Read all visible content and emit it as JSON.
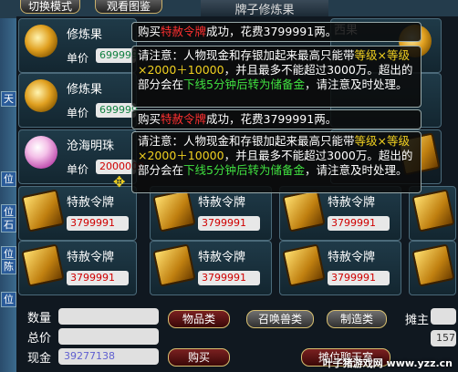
{
  "tabs": {
    "switch_mode": "切换模式",
    "view_catalog": "观看图鉴"
  },
  "window_title": "牌子修炼果",
  "left_strip": [
    "天",
    "位",
    "位",
    "石",
    "位",
    "陈",
    "位"
  ],
  "items": [
    {
      "name": "修炼果",
      "price_label": "单价",
      "price": "699999",
      "icon": "fruit-icon"
    },
    {
      "name": "修炼果",
      "price_label": "单价",
      "price": "699999",
      "icon": "fruit-icon"
    },
    {
      "name": "沧海明珠",
      "price_label": "单价",
      "price": "2000000",
      "icon": "pearl-icon"
    },
    {
      "name": "特赦令牌",
      "price": "3799991",
      "icon": "token-icon"
    },
    {
      "name": "特赦令牌",
      "price": "3799991",
      "icon": "token-icon"
    },
    {
      "name": "特赦令牌",
      "price": "3799991",
      "icon": "token-icon"
    },
    {
      "name": "特赦令牌",
      "price": "3799991",
      "icon": "token-icon"
    },
    {
      "name": "特赦令牌",
      "price": "3799991",
      "icon": "token-icon"
    },
    {
      "name": "特赦令牌",
      "price": "3799991",
      "icon": "token-icon"
    },
    {
      "name": "特赦令牌",
      "price": "3799991",
      "icon": "token-icon"
    }
  ],
  "messages": {
    "buy_prefix": "购买",
    "buy_item": "特赦令牌",
    "buy_suffix": "成功，花费3799991两。",
    "notice_1": "请注意：人物现金和存银加起来最高只能带",
    "notice_level": "等级×等级×2000＋10000",
    "notice_2": "，并且最多不能超过3000万。超出的部分会在",
    "notice_time": "下线5分钟后转为储备金",
    "notice_3": "，请注意及时处理。",
    "partial_right": "西果"
  },
  "bottom": {
    "qty_label": "数量",
    "total_label": "总价",
    "cash_label": "现金",
    "cash_value": "39277138",
    "buy_button": "购买",
    "tab_goods": "物品类",
    "tab_pets": "召唤兽类",
    "tab_craft": "制造类",
    "owner_label": "摊主",
    "chat_button": "摊位聊天室",
    "side_value": "157"
  },
  "watermark": "叶子猪游戏网 www.yzz.cn"
}
